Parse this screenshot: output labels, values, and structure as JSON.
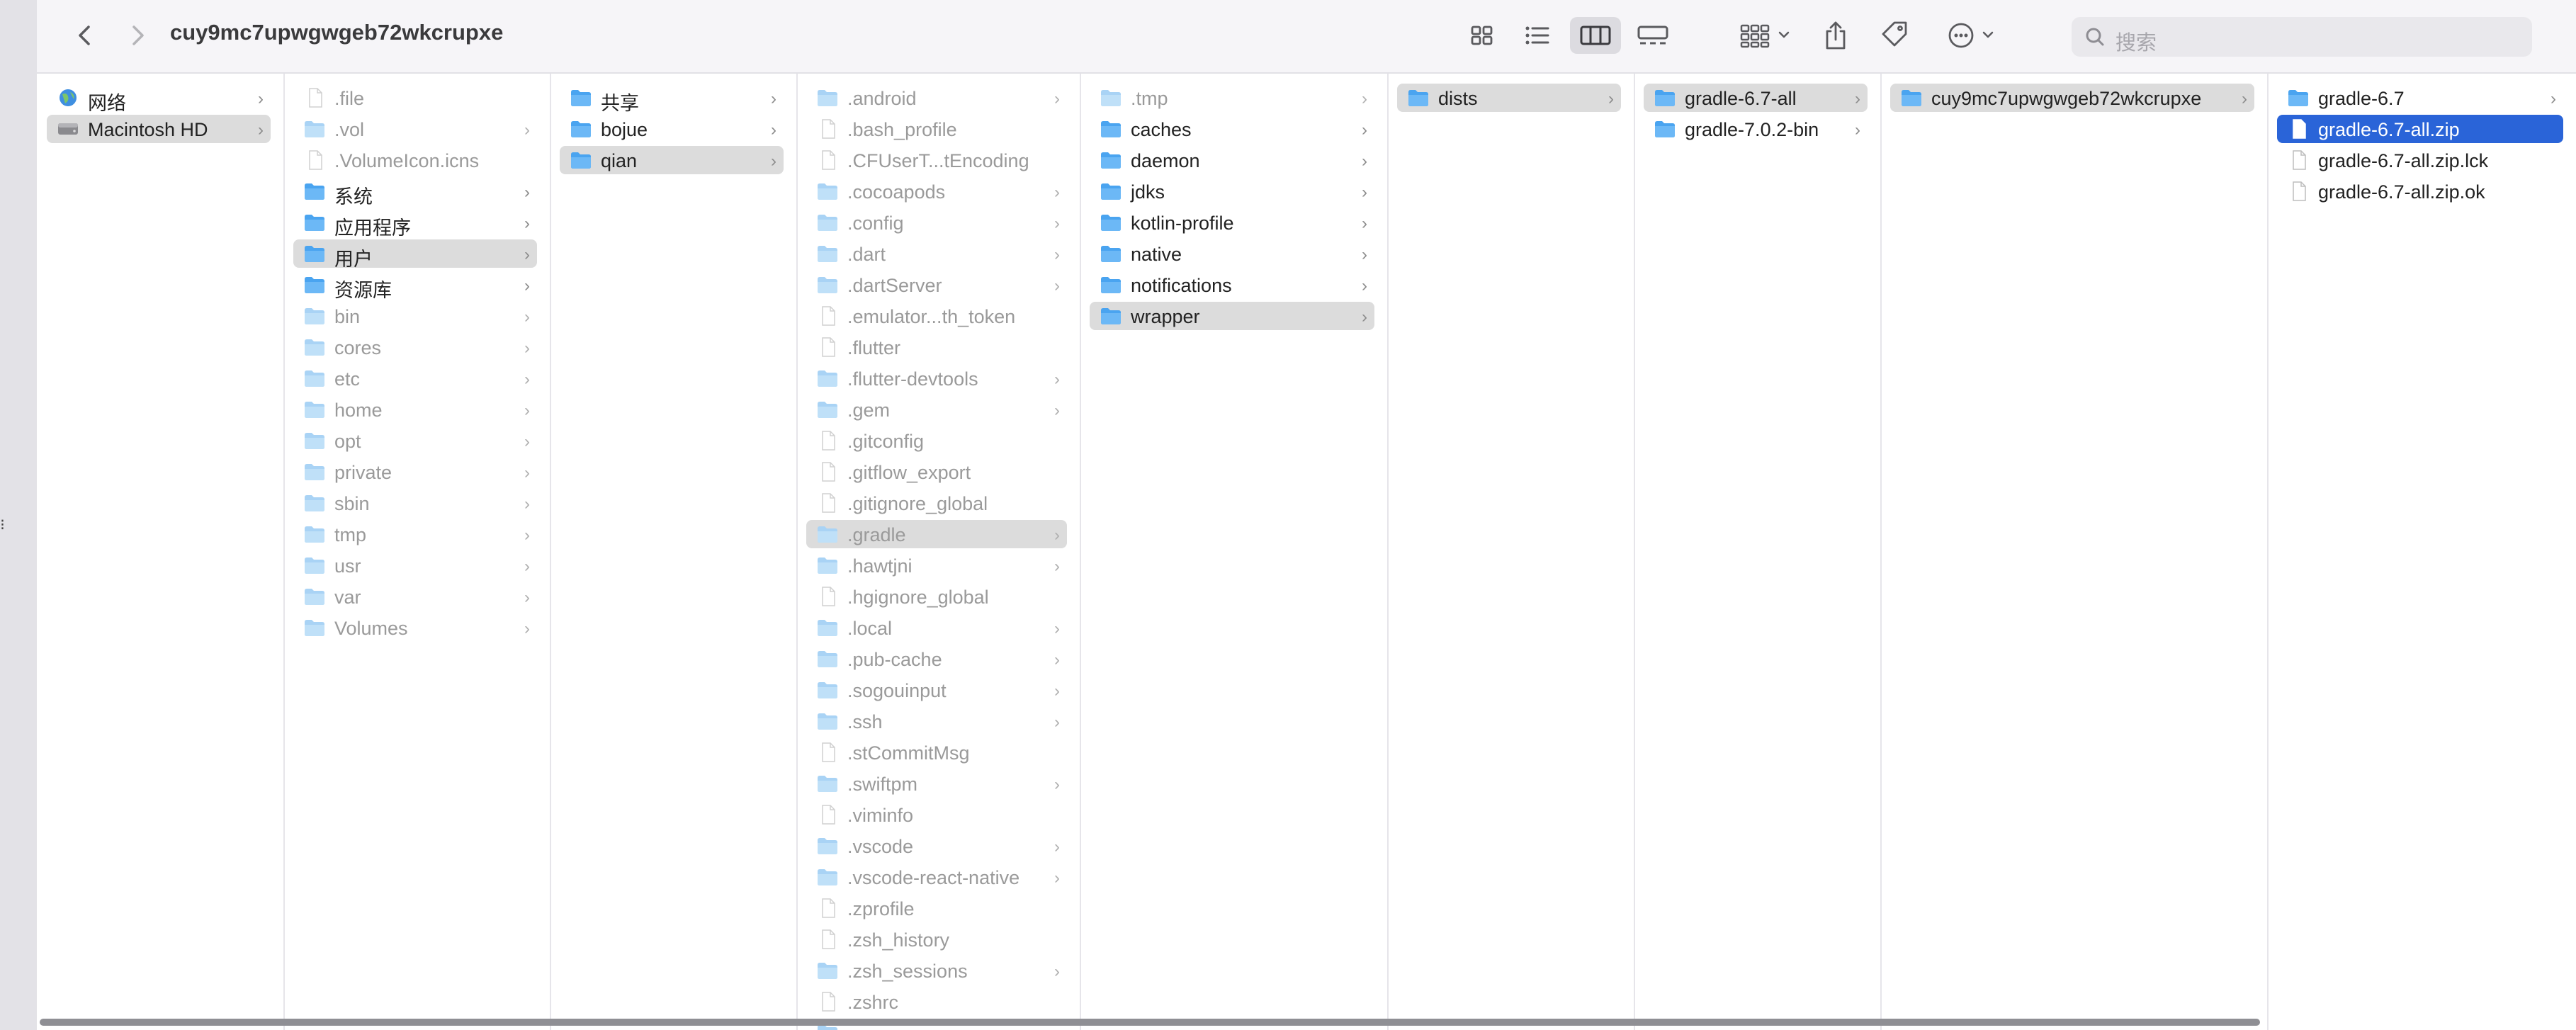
{
  "window": {
    "title": "cuy9mc7upwgwgeb72wkcrupxe"
  },
  "toolbar": {
    "back_icon": "chevron-left-icon",
    "forward_icon": "chevron-right-icon",
    "view_modes": [
      "icon-view",
      "list-view",
      "column-view",
      "gallery-view"
    ],
    "selected_view": "column-view",
    "group_icon": "group-by-icon",
    "share_icon": "share-icon",
    "tag_icon": "tag-icon",
    "more_icon": "ellipsis-circle-icon",
    "search_placeholder": "搜索"
  },
  "colors": {
    "accent": "#2a64d8",
    "folder": "#4aa4f0",
    "selection_gray": "#dcdcdc"
  },
  "columns": [
    {
      "items": [
        {
          "label": "网络",
          "icon": "globe-icon",
          "dim": false,
          "arrow": true,
          "sel": ""
        },
        {
          "label": "Macintosh HD",
          "icon": "drive-icon",
          "dim": false,
          "arrow": true,
          "sel": "gray"
        }
      ]
    },
    {
      "items": [
        {
          "label": ".file",
          "icon": "file-icon",
          "dim": true,
          "arrow": false,
          "sel": ""
        },
        {
          "label": ".vol",
          "icon": "folder-icon",
          "dim": true,
          "arrow": true,
          "sel": ""
        },
        {
          "label": ".VolumeIcon.icns",
          "icon": "file-icon",
          "dim": true,
          "arrow": false,
          "sel": ""
        },
        {
          "label": "系统",
          "icon": "folder-icon",
          "dim": false,
          "arrow": true,
          "sel": ""
        },
        {
          "label": "应用程序",
          "icon": "folder-icon",
          "dim": false,
          "arrow": true,
          "sel": ""
        },
        {
          "label": "用户",
          "icon": "folder-icon",
          "dim": false,
          "arrow": true,
          "sel": "gray"
        },
        {
          "label": "资源库",
          "icon": "folder-icon",
          "dim": false,
          "arrow": true,
          "sel": ""
        },
        {
          "label": "bin",
          "icon": "folder-icon",
          "dim": true,
          "arrow": true,
          "sel": ""
        },
        {
          "label": "cores",
          "icon": "folder-icon",
          "dim": true,
          "arrow": true,
          "sel": ""
        },
        {
          "label": "etc",
          "icon": "folder-icon",
          "dim": true,
          "arrow": true,
          "sel": ""
        },
        {
          "label": "home",
          "icon": "folder-icon",
          "dim": true,
          "arrow": true,
          "sel": ""
        },
        {
          "label": "opt",
          "icon": "folder-icon",
          "dim": true,
          "arrow": true,
          "sel": ""
        },
        {
          "label": "private",
          "icon": "folder-icon",
          "dim": true,
          "arrow": true,
          "sel": ""
        },
        {
          "label": "sbin",
          "icon": "folder-icon",
          "dim": true,
          "arrow": true,
          "sel": ""
        },
        {
          "label": "tmp",
          "icon": "folder-icon",
          "dim": true,
          "arrow": true,
          "sel": ""
        },
        {
          "label": "usr",
          "icon": "folder-icon",
          "dim": true,
          "arrow": true,
          "sel": ""
        },
        {
          "label": "var",
          "icon": "folder-icon",
          "dim": true,
          "arrow": true,
          "sel": ""
        },
        {
          "label": "Volumes",
          "icon": "folder-icon",
          "dim": true,
          "arrow": true,
          "sel": ""
        }
      ]
    },
    {
      "items": [
        {
          "label": "共享",
          "icon": "folder-icon",
          "dim": false,
          "arrow": true,
          "sel": ""
        },
        {
          "label": "bojue",
          "icon": "folder-icon",
          "dim": false,
          "arrow": true,
          "sel": ""
        },
        {
          "label": "qian",
          "icon": "folder-icon",
          "dim": false,
          "arrow": true,
          "sel": "gray"
        }
      ]
    },
    {
      "items": [
        {
          "label": ".android",
          "icon": "folder-icon",
          "dim": true,
          "arrow": true,
          "sel": ""
        },
        {
          "label": ".bash_profile",
          "icon": "file-icon",
          "dim": true,
          "arrow": false,
          "sel": ""
        },
        {
          "label": ".CFUserT...tEncoding",
          "icon": "file-icon",
          "dim": true,
          "arrow": false,
          "sel": ""
        },
        {
          "label": ".cocoapods",
          "icon": "folder-icon",
          "dim": true,
          "arrow": true,
          "sel": ""
        },
        {
          "label": ".config",
          "icon": "folder-icon",
          "dim": true,
          "arrow": true,
          "sel": ""
        },
        {
          "label": ".dart",
          "icon": "folder-icon",
          "dim": true,
          "arrow": true,
          "sel": ""
        },
        {
          "label": ".dartServer",
          "icon": "folder-icon",
          "dim": true,
          "arrow": true,
          "sel": ""
        },
        {
          "label": ".emulator...th_token",
          "icon": "file-icon",
          "dim": true,
          "arrow": false,
          "sel": ""
        },
        {
          "label": ".flutter",
          "icon": "file-icon",
          "dim": true,
          "arrow": false,
          "sel": ""
        },
        {
          "label": ".flutter-devtools",
          "icon": "folder-icon",
          "dim": true,
          "arrow": true,
          "sel": ""
        },
        {
          "label": ".gem",
          "icon": "folder-icon",
          "dim": true,
          "arrow": true,
          "sel": ""
        },
        {
          "label": ".gitconfig",
          "icon": "file-icon",
          "dim": true,
          "arrow": false,
          "sel": ""
        },
        {
          "label": ".gitflow_export",
          "icon": "file-icon",
          "dim": true,
          "arrow": false,
          "sel": ""
        },
        {
          "label": ".gitignore_global",
          "icon": "file-icon",
          "dim": true,
          "arrow": false,
          "sel": ""
        },
        {
          "label": ".gradle",
          "icon": "folder-icon",
          "dim": true,
          "arrow": true,
          "sel": "gray"
        },
        {
          "label": ".hawtjni",
          "icon": "folder-icon",
          "dim": true,
          "arrow": true,
          "sel": ""
        },
        {
          "label": ".hgignore_global",
          "icon": "file-icon",
          "dim": true,
          "arrow": false,
          "sel": ""
        },
        {
          "label": ".local",
          "icon": "folder-icon",
          "dim": true,
          "arrow": true,
          "sel": ""
        },
        {
          "label": ".pub-cache",
          "icon": "folder-icon",
          "dim": true,
          "arrow": true,
          "sel": ""
        },
        {
          "label": ".sogouinput",
          "icon": "folder-icon",
          "dim": true,
          "arrow": true,
          "sel": ""
        },
        {
          "label": ".ssh",
          "icon": "folder-icon",
          "dim": true,
          "arrow": true,
          "sel": ""
        },
        {
          "label": ".stCommitMsg",
          "icon": "file-icon",
          "dim": true,
          "arrow": false,
          "sel": ""
        },
        {
          "label": ".swiftpm",
          "icon": "folder-icon",
          "dim": true,
          "arrow": true,
          "sel": ""
        },
        {
          "label": ".viminfo",
          "icon": "file-icon",
          "dim": true,
          "arrow": false,
          "sel": ""
        },
        {
          "label": ".vscode",
          "icon": "folder-icon",
          "dim": true,
          "arrow": true,
          "sel": ""
        },
        {
          "label": ".vscode-react-native",
          "icon": "folder-icon",
          "dim": true,
          "arrow": true,
          "sel": ""
        },
        {
          "label": ".zprofile",
          "icon": "file-icon",
          "dim": true,
          "arrow": false,
          "sel": ""
        },
        {
          "label": ".zsh_history",
          "icon": "file-icon",
          "dim": true,
          "arrow": false,
          "sel": ""
        },
        {
          "label": ".zsh_sessions",
          "icon": "folder-icon",
          "dim": true,
          "arrow": true,
          "sel": ""
        },
        {
          "label": ".zshrc",
          "icon": "file-icon",
          "dim": true,
          "arrow": false,
          "sel": ""
        },
        {
          "label": "",
          "icon": "folder-icon",
          "dim": true,
          "arrow": true,
          "sel": ""
        }
      ]
    },
    {
      "items": [
        {
          "label": ".tmp",
          "icon": "folder-icon",
          "dim": true,
          "arrow": true,
          "sel": ""
        },
        {
          "label": "caches",
          "icon": "folder-icon",
          "dim": false,
          "arrow": true,
          "sel": ""
        },
        {
          "label": "daemon",
          "icon": "folder-icon",
          "dim": false,
          "arrow": true,
          "sel": ""
        },
        {
          "label": "jdks",
          "icon": "folder-icon",
          "dim": false,
          "arrow": true,
          "sel": ""
        },
        {
          "label": "kotlin-profile",
          "icon": "folder-icon",
          "dim": false,
          "arrow": true,
          "sel": ""
        },
        {
          "label": "native",
          "icon": "folder-icon",
          "dim": false,
          "arrow": true,
          "sel": ""
        },
        {
          "label": "notifications",
          "icon": "folder-icon",
          "dim": false,
          "arrow": true,
          "sel": ""
        },
        {
          "label": "wrapper",
          "icon": "folder-icon",
          "dim": false,
          "arrow": true,
          "sel": "gray"
        }
      ]
    },
    {
      "items": [
        {
          "label": "dists",
          "icon": "folder-icon",
          "dim": false,
          "arrow": true,
          "sel": "gray"
        }
      ]
    },
    {
      "items": [
        {
          "label": "gradle-6.7-all",
          "icon": "folder-icon",
          "dim": false,
          "arrow": true,
          "sel": "gray"
        },
        {
          "label": "gradle-7.0.2-bin",
          "icon": "folder-icon",
          "dim": false,
          "arrow": true,
          "sel": ""
        }
      ]
    },
    {
      "items": [
        {
          "label": "cuy9mc7upwgwgeb72wkcrupxe",
          "icon": "folder-icon",
          "dim": false,
          "arrow": true,
          "sel": "gray"
        }
      ]
    },
    {
      "items": [
        {
          "label": "gradle-6.7",
          "icon": "folder-icon",
          "dim": false,
          "arrow": true,
          "sel": ""
        },
        {
          "label": "gradle-6.7-all.zip",
          "icon": "file-icon",
          "dim": false,
          "arrow": false,
          "sel": "blue"
        },
        {
          "label": "gradle-6.7-all.zip.lck",
          "icon": "file-icon",
          "dim": false,
          "arrow": false,
          "sel": ""
        },
        {
          "label": "gradle-6.7-all.zip.ok",
          "icon": "file-icon",
          "dim": false,
          "arrow": false,
          "sel": ""
        }
      ]
    }
  ]
}
